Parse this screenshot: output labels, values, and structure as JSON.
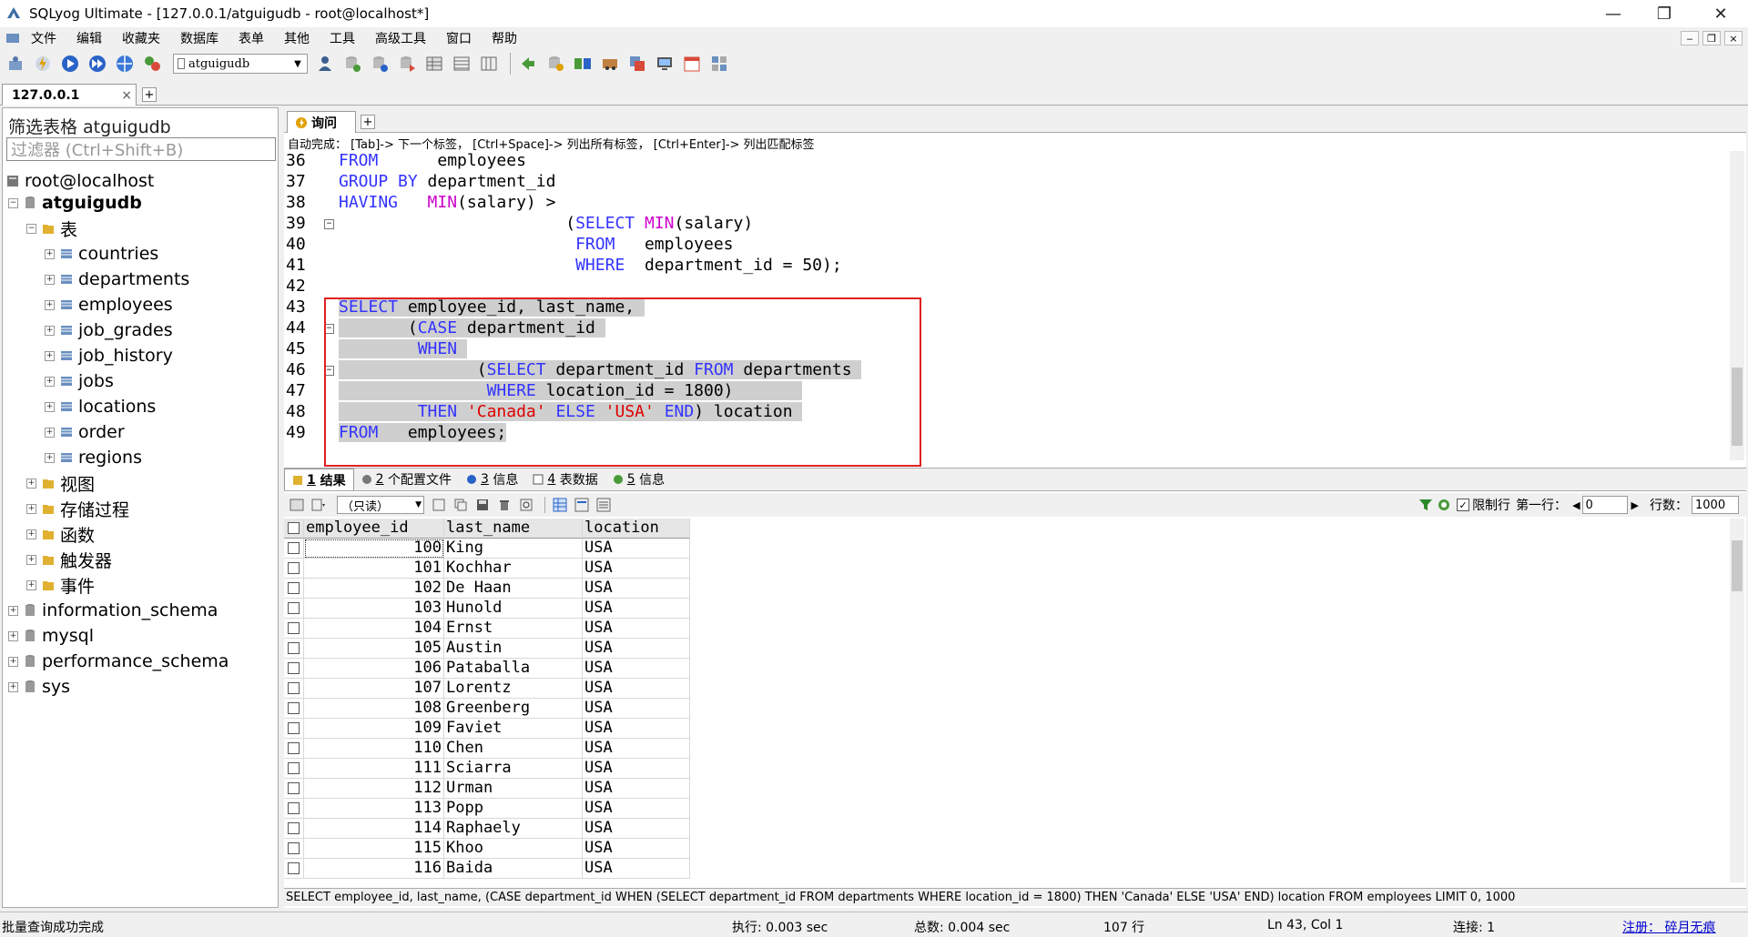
{
  "window": {
    "title": "SQLyog Ultimate - [127.0.0.1/atguigudb - root@localhost*]",
    "controls": {
      "minimize": "—",
      "maximize": "❐",
      "close": "✕"
    }
  },
  "menu": {
    "items": [
      "文件",
      "编辑",
      "收藏夹",
      "数据库",
      "表单",
      "其他",
      "工具",
      "高级工具",
      "窗口",
      "帮助"
    ],
    "mdi": {
      "minimize": "‒",
      "restore": "❐",
      "close": "×"
    }
  },
  "toolbar": {
    "database_select": "atguigudb"
  },
  "connection_tab": {
    "label": "127.0.0.1",
    "close": "×",
    "add": "+"
  },
  "object_browser": {
    "filter_label": "筛选表格 atguigudb",
    "filter_placeholder": "过滤器 (Ctrl+Shift+B)",
    "root": "root@localhost",
    "db": "atguigudb",
    "tables_folder": "表",
    "tables": [
      "countries",
      "departments",
      "employees",
      "job_grades",
      "job_history",
      "jobs",
      "locations",
      "order",
      "regions"
    ],
    "folders": [
      "视图",
      "存储过程",
      "函数",
      "触发器",
      "事件"
    ],
    "other_dbs": [
      "information_schema",
      "mysql",
      "performance_schema",
      "sys"
    ],
    "expand_plus": "+",
    "expand_minus": "−"
  },
  "query_tab": {
    "label": "询问",
    "add": "+"
  },
  "autocomplete_hint": "自动完成： [Tab]-> 下一个标签， [Ctrl+Space]-> 列出所有标签， [Ctrl+Enter]-> 列出匹配标签",
  "editor": {
    "line_numbers": [
      "36",
      "37",
      "38",
      "39",
      "40",
      "41",
      "42",
      "43",
      "44",
      "45",
      "46",
      "47",
      "48",
      "49"
    ],
    "fold_minus": "−"
  },
  "result_tabs": [
    {
      "num": "1",
      "label": "结果"
    },
    {
      "num": "2",
      "label": "个配置文件"
    },
    {
      "num": "3",
      "label": "信息"
    },
    {
      "num": "4",
      "label": "表数据"
    },
    {
      "num": "5",
      "label": "信息"
    }
  ],
  "result_toolbar": {
    "readonly": "（只读）",
    "limit_label": "限制行",
    "first_row_label": "第一行：",
    "first_row_value": "0",
    "rows_label": "行数：",
    "rows_value": "1000",
    "limit_checked": "✓"
  },
  "grid": {
    "columns": [
      "employee_id",
      "last_name",
      "location"
    ],
    "rows": [
      [
        "100",
        "King",
        "USA"
      ],
      [
        "101",
        "Kochhar",
        "USA"
      ],
      [
        "102",
        "De Haan",
        "USA"
      ],
      [
        "103",
        "Hunold",
        "USA"
      ],
      [
        "104",
        "Ernst",
        "USA"
      ],
      [
        "105",
        "Austin",
        "USA"
      ],
      [
        "106",
        "Pataballa",
        "USA"
      ],
      [
        "107",
        "Lorentz",
        "USA"
      ],
      [
        "108",
        "Greenberg",
        "USA"
      ],
      [
        "109",
        "Faviet",
        "USA"
      ],
      [
        "110",
        "Chen",
        "USA"
      ],
      [
        "111",
        "Sciarra",
        "USA"
      ],
      [
        "112",
        "Urman",
        "USA"
      ],
      [
        "113",
        "Popp",
        "USA"
      ],
      [
        "114",
        "Raphaely",
        "USA"
      ],
      [
        "115",
        "Khoo",
        "USA"
      ],
      [
        "116",
        "Baida",
        "USA"
      ]
    ]
  },
  "executed_sql": "SELECT employee_id, last_name, (CASE department_id WHEN (SELECT department_id FROM departments WHERE location_id = 1800) THEN 'Canada' ELSE 'USA' END) location FROM employees LIMIT 0, 1000",
  "status": {
    "message": "批量查询成功完成",
    "exec": "执行: 0.003 sec",
    "total": "总数: 0.004 sec",
    "rows": "107 行",
    "cursor": "Ln 43, Col 1",
    "connections": "连接: 1",
    "register": "注册： 碎月无痕"
  },
  "colors": {
    "keyword": "#3333ff",
    "function": "#cc00cc",
    "string": "#dd0000",
    "highlight_box": "#e02020"
  }
}
